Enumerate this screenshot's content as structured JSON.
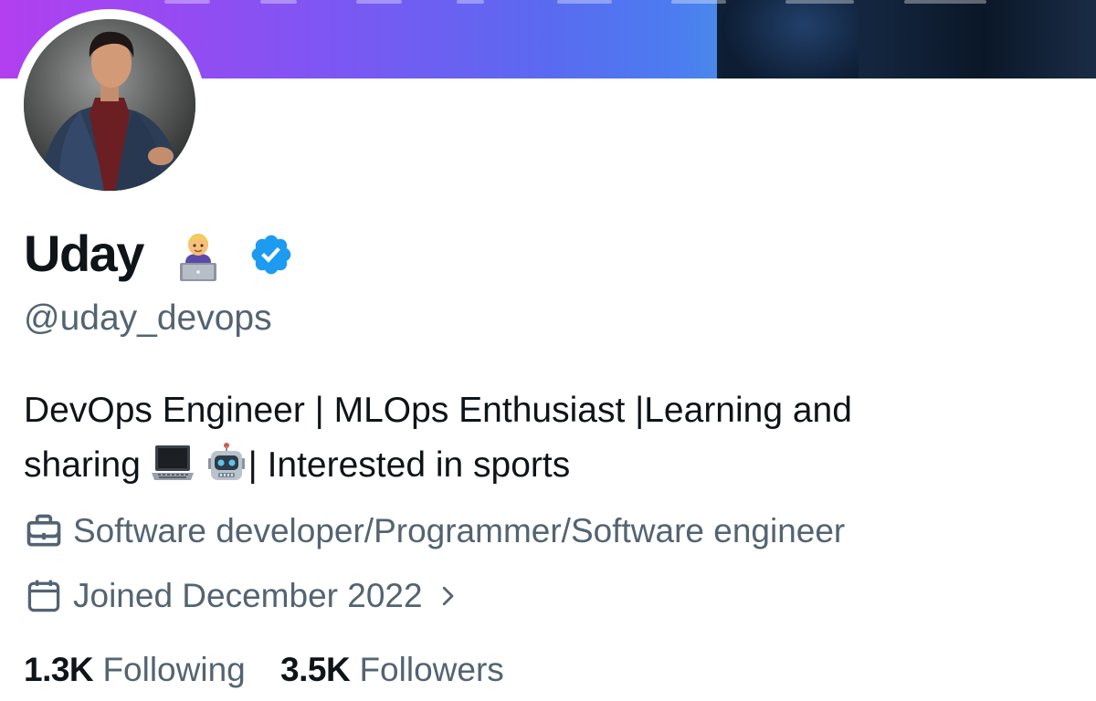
{
  "profile": {
    "display_name": "Uday",
    "name_emoji": "technologist-emoji",
    "verified": true,
    "handle": "@uday_devops",
    "bio": {
      "line1": "DevOps Engineer | MLOps Enthusiast |Learning and",
      "line2_prefix": "sharing",
      "line2_suffix": "| Interested in sports",
      "emojis": [
        "laptop-emoji",
        "robot-emoji"
      ]
    },
    "profession": "Software developer/Programmer/Software engineer",
    "joined": "Joined December 2022",
    "following_count": "1.3K",
    "following_label": "Following",
    "followers_count": "3.5K",
    "followers_label": "Followers"
  },
  "colors": {
    "accent_blue": "#1d9bf0",
    "text_primary": "#0f1419",
    "text_secondary": "#536471",
    "banner_gradient": [
      "#b23ff0",
      "#4b7df0",
      "#0d1e36"
    ]
  },
  "icons": {
    "verified": "verified-badge-icon",
    "profession": "briefcase-icon",
    "joined": "calendar-icon",
    "chevron": "chevron-right-icon"
  }
}
